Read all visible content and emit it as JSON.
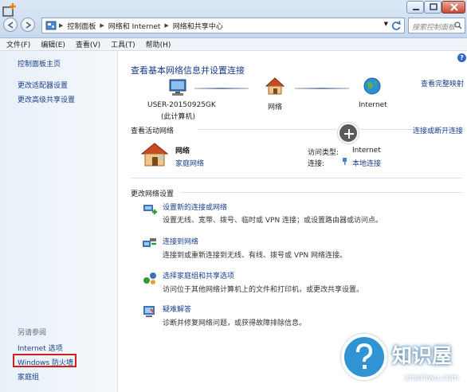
{
  "titlebar": {
    "breadcrumb": [
      "控制面板",
      "网络和 Internet",
      "网络和共享中心"
    ],
    "search_placeholder": "搜索控制面板"
  },
  "menu": [
    "文件(F)",
    "编辑(E)",
    "查看(V)",
    "工具(T)",
    "帮助(H)"
  ],
  "sidebar": {
    "top_links": [
      "控制面板主页",
      "更改适配器设置",
      "更改高级共享设置"
    ],
    "see_also_title": "另请参阅",
    "see_also_links": [
      "Internet 选项",
      "Windows 防火墙",
      "家庭组"
    ]
  },
  "main": {
    "title": "查看基本网络信息并设置连接",
    "full_map_link": "查看完整映射",
    "nodes": {
      "computer_name": "USER-20150925GK",
      "computer_sub": "(此计算机)",
      "network": "网络",
      "internet": "Internet"
    },
    "active_section_title": "查看活动网络",
    "connect_link": "连接或断开连接",
    "active_network": {
      "name": "网络",
      "type": "家庭网络",
      "access_label": "访问类型:",
      "access_value": "Internet",
      "connection_label": "连接:",
      "connection_value": "本地连接"
    },
    "change_section_title": "更改网络设置",
    "tasks": [
      {
        "title": "设置新的连接或网络",
        "desc": "设置无线、宽带、拨号、临时或 VPN 连接；或设置路由器或访问点。"
      },
      {
        "title": "连接到网络",
        "desc": "连接到或重新连接到无线、有线、拨号或 VPN 网络连接。"
      },
      {
        "title": "选择家庭组和共享选项",
        "desc": "访问位于其他网络计算机上的文件和打印机，或更改共享设置。"
      },
      {
        "title": "疑难解答",
        "desc": "诊断并修复网络问题，或获得故障排除信息。"
      }
    ]
  },
  "watermark": {
    "text": "知识屋",
    "sub": "zhishiwu.com"
  }
}
